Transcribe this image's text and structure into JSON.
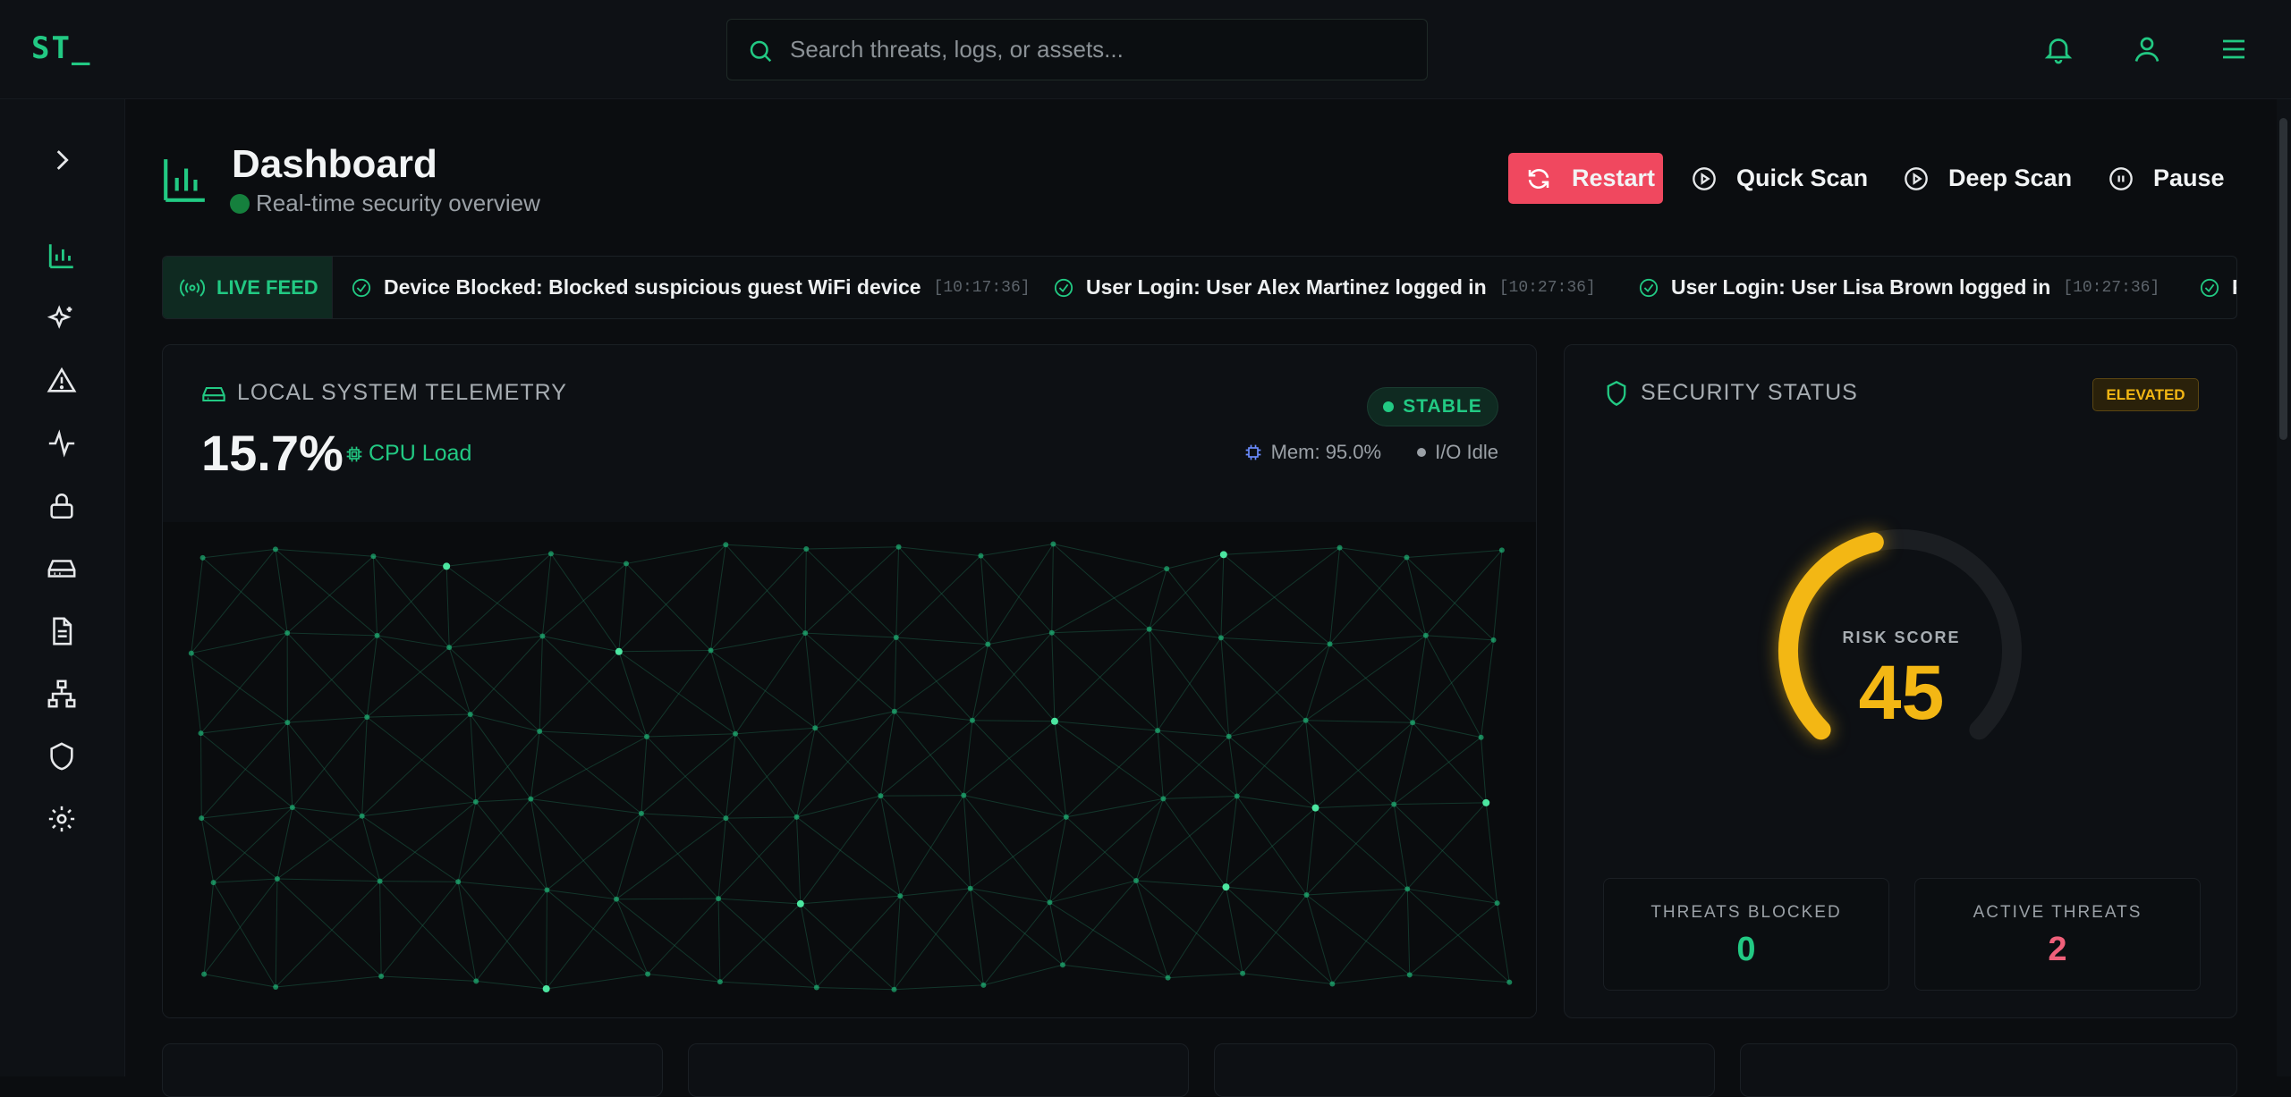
{
  "app": {
    "logo": "ST_"
  },
  "search": {
    "placeholder": "Search threats, logs, or assets..."
  },
  "header": {
    "title": "Dashboard",
    "subtitle": "Real-time security overview"
  },
  "actions": {
    "restart": "Restart",
    "quick_scan": "Quick Scan",
    "deep_scan": "Deep Scan",
    "pause": "Pause"
  },
  "feed": {
    "label": "LIVE FEED",
    "items": [
      {
        "text": "Device Blocked: Blocked suspicious guest WiFi device",
        "time": "[10:17:36]"
      },
      {
        "text": "User Login: User Alex Martinez logged in",
        "time": "[10:27:36]"
      },
      {
        "text": "User Login: User Lisa Brown logged in",
        "time": "[10:27:36]"
      },
      {
        "text": "P",
        "time": ""
      }
    ]
  },
  "telemetry": {
    "title": "LOCAL SYSTEM TELEMETRY",
    "cpu_value": "15.7%",
    "cpu_label": "CPU Load",
    "status": "STABLE",
    "mem": "Mem: 95.0%",
    "io": "I/O Idle"
  },
  "security": {
    "title": "SECURITY STATUS",
    "level": "ELEVATED",
    "risk_label": "RISK SCORE",
    "risk_score": "45",
    "risk_fraction": 0.45,
    "threats_blocked_label": "THREATS BLOCKED",
    "threats_blocked": "0",
    "active_threats_label": "ACTIVE THREATS",
    "active_threats": "2"
  },
  "colors": {
    "accent": "#22c983",
    "danger": "#f0485f",
    "warning": "#f3b714",
    "bg": "#0b0d10"
  },
  "icons": {
    "sidebar": [
      "chevron-right-icon",
      "chart-icon",
      "sparkles-icon",
      "alert-triangle-icon",
      "activity-icon",
      "lock-icon",
      "hard-drive-icon",
      "file-text-icon",
      "network-icon",
      "shield-icon",
      "settings-icon"
    ],
    "top": [
      "bell-icon",
      "user-icon",
      "menu-icon"
    ]
  }
}
